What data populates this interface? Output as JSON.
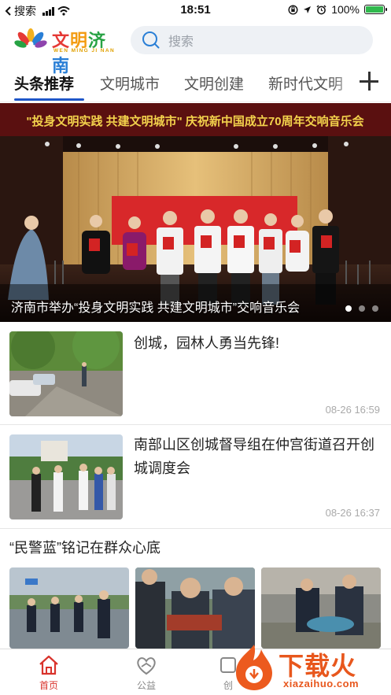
{
  "status_bar": {
    "carrier": "搜索",
    "time": "18:51",
    "battery": "100%",
    "battery_level": 1.0
  },
  "header": {
    "logo_text": "文明济南",
    "logo_pinyin": "WEN MING JI NAN",
    "search_placeholder": "搜索"
  },
  "tabs": [
    {
      "label": "头条推荐",
      "active": true
    },
    {
      "label": "文明城市",
      "active": false
    },
    {
      "label": "文明创建",
      "active": false
    },
    {
      "label": "新时代文明",
      "active": false
    }
  ],
  "banner": {
    "stage_banner_text": "\"投身文明实践 共建文明城市\" 庆祝新中国成立70周年交响音乐会",
    "caption": "济南市举办“投身文明实践 共建文明城市”交响音乐会",
    "slide_count": 3,
    "active_slide": 1
  },
  "news": [
    {
      "title": "创城，园林人勇当先锋!",
      "time": "08-26 16:59"
    },
    {
      "title": "南部山区创城督导组在仲宫街道召开创城调度会",
      "time": "08-26 16:37"
    }
  ],
  "multi_news": {
    "title": "“民警蓝”铭记在群众心底"
  },
  "bottom_nav": [
    {
      "label": "首页",
      "icon": "home-icon",
      "active": true
    },
    {
      "label": "公益",
      "icon": "heart-hands-icon",
      "active": false
    },
    {
      "label": "创",
      "icon": "create-icon",
      "active": false
    }
  ],
  "watermark": {
    "text": "下载火",
    "url": "xiazaihuo.com"
  },
  "colors": {
    "accent": "#1e56c8",
    "nav_active": "#d9332c",
    "watermark": "#e8571d"
  }
}
